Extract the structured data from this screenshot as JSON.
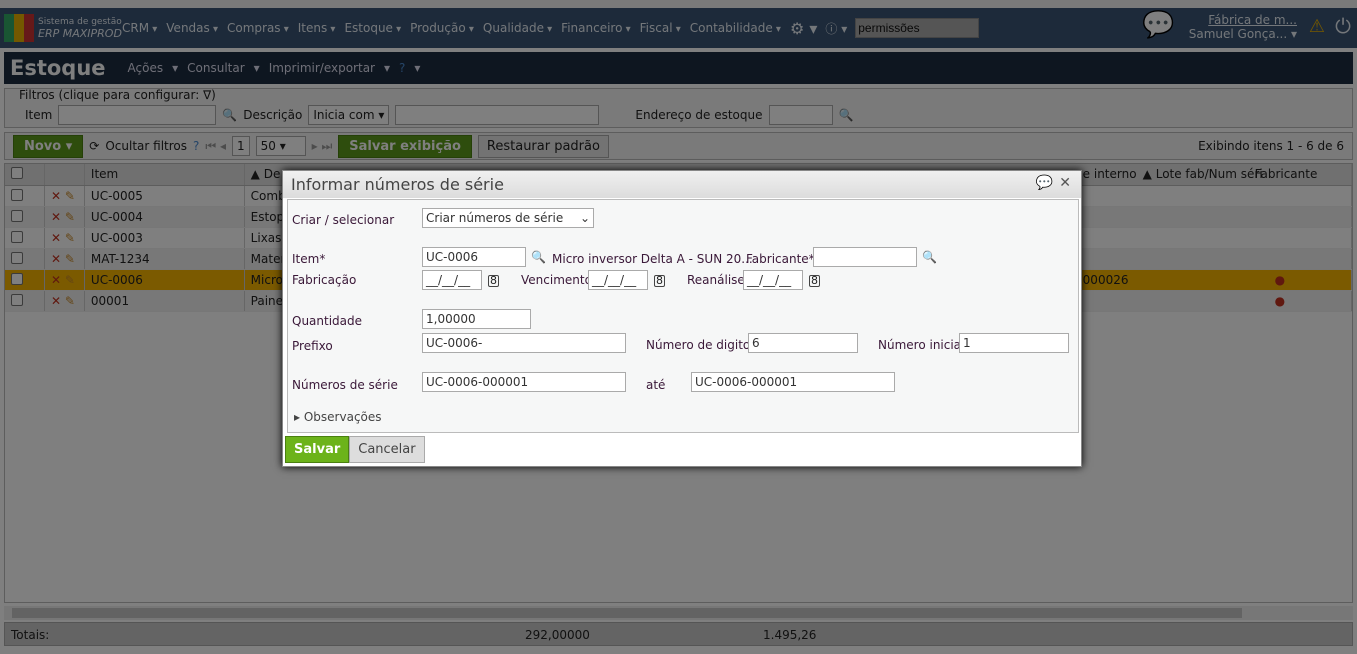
{
  "nav": {
    "logo_line1": "Sistema de gestão",
    "logo_line2": "ERP MAXIPROD",
    "menus": [
      "CRM",
      "Vendas",
      "Compras",
      "Itens",
      "Estoque",
      "Produção",
      "Qualidade",
      "Financeiro",
      "Fiscal",
      "Contabilidade"
    ],
    "search_value": "permissões",
    "company": "Fábrica de m...",
    "user": "Samuel Gonça..."
  },
  "page": {
    "title": "Estoque",
    "menus": [
      "Ações",
      "Consultar",
      "Imprimir/exportar"
    ]
  },
  "filters": {
    "legend": "Filtros (clique para configurar: ∇)",
    "item_label": "Item",
    "descricao_label": "Descrição",
    "descricao_mode": "Inicia com",
    "endereco_label": "Endereço de estoque"
  },
  "toolbar": {
    "novo": "Novo",
    "ocultar": "Ocultar filtros",
    "page": "1",
    "per_page": "50",
    "salvar_exibicao": "Salvar exibição",
    "restaurar": "Restaurar padrão",
    "info": "Exibindo itens 1 - 6 de 6"
  },
  "grid": {
    "headers": {
      "item": "Item",
      "desc": "▲ De",
      "interno": "e interno",
      "lote": "▲ Lote fab/Num séri",
      "fabricante": "Fabricante"
    },
    "rows": [
      {
        "item": "UC-0005",
        "desc": "Comb"
      },
      {
        "item": "UC-0004",
        "desc": "Estopa"
      },
      {
        "item": "UC-0003",
        "desc": "Lixas"
      },
      {
        "item": "MAT-1234",
        "desc": "Mater"
      },
      {
        "item": "UC-0006",
        "desc": "Micro",
        "interno": "000026"
      },
      {
        "item": "00001",
        "desc": "Painel"
      }
    ],
    "totals_label": "Totais:",
    "total1": "292,00000",
    "total2": "1.495,26"
  },
  "dialog": {
    "title": "Informar números de série",
    "criar_label": "Criar / selecionar",
    "criar_value": "Criar números de série",
    "item_label": "Item*",
    "item_value": "UC-0006",
    "item_desc": "Micro inversor Delta A - SUN 20...",
    "fabricante_label": "Fabricante*",
    "fabricante_value": "",
    "fabricacao_label": "Fabricação",
    "fabricacao_value": "__/__/__",
    "vencimento_label": "Vencimento",
    "vencimento_value": "__/__/__",
    "reanalise_label": "Reanálise",
    "reanalise_value": "__/__/__",
    "quantidade_label": "Quantidade",
    "quantidade_value": "1,00000",
    "prefixo_label": "Prefixo",
    "prefixo_value": "UC-0006-",
    "digitos_label": "Número de digitos",
    "digitos_value": "6",
    "inicial_label": "Número inicial",
    "inicial_value": "1",
    "series_label": "Números de série",
    "series_from": "UC-0006-000001",
    "ate_label": "até",
    "series_to": "UC-0006-000001",
    "observacoes": "Observações",
    "salvar": "Salvar",
    "cancelar": "Cancelar"
  },
  "colors": {
    "accent_green": "#5c9a1a",
    "nav_blue": "#3a5575",
    "selected_row": "#f6b400"
  }
}
